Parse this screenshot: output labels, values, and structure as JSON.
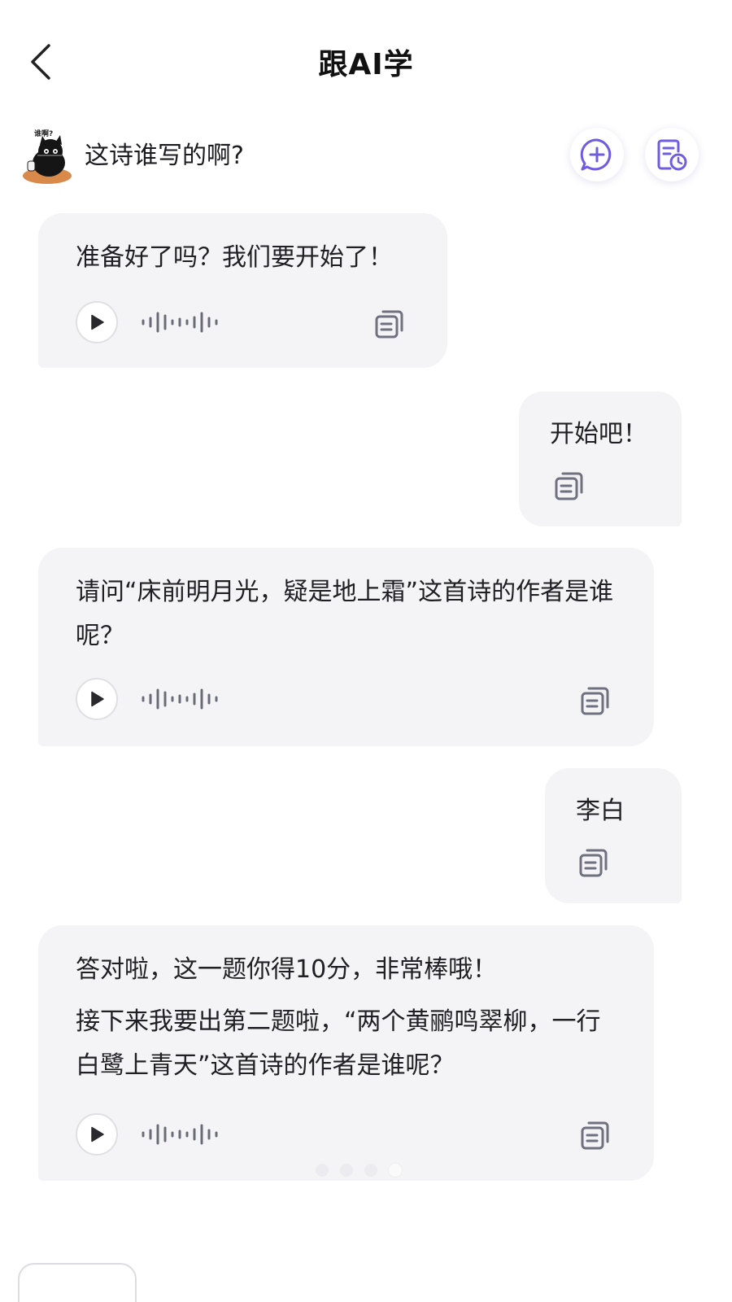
{
  "header": {
    "title": "跟AI学",
    "back_icon": "chevron-left-icon"
  },
  "topic": {
    "avatar_caption": "谁啊?",
    "text": "这诗谁写的啊?",
    "actions": [
      {
        "name": "new-chat",
        "icon": "chat-plus-icon"
      },
      {
        "name": "history",
        "icon": "history-clock-icon"
      }
    ]
  },
  "messages": [
    {
      "role": "ai",
      "paragraphs": [
        "准备好了吗？我们要开始了！"
      ],
      "has_audio": true
    },
    {
      "role": "user",
      "text": "开始吧！"
    },
    {
      "role": "ai",
      "paragraphs": [
        "请问“床前明月光，疑是地上霜”这首诗的作者是谁呢？"
      ],
      "has_audio": true
    },
    {
      "role": "user",
      "text": "李白"
    },
    {
      "role": "ai",
      "paragraphs": [
        "答对啦，这一题你得10分，非常棒哦！",
        "接下来我要出第二题啦，“两个黄鹂鸣翠柳，一行白鹭上青天”这首诗的作者是谁呢？"
      ],
      "has_audio": true
    }
  ],
  "pagination": {
    "total": 4,
    "active": 4
  },
  "colors": {
    "accent": "#6f5ce0",
    "bubble_bg": "#f4f4f6",
    "icon_gray": "#707080"
  }
}
